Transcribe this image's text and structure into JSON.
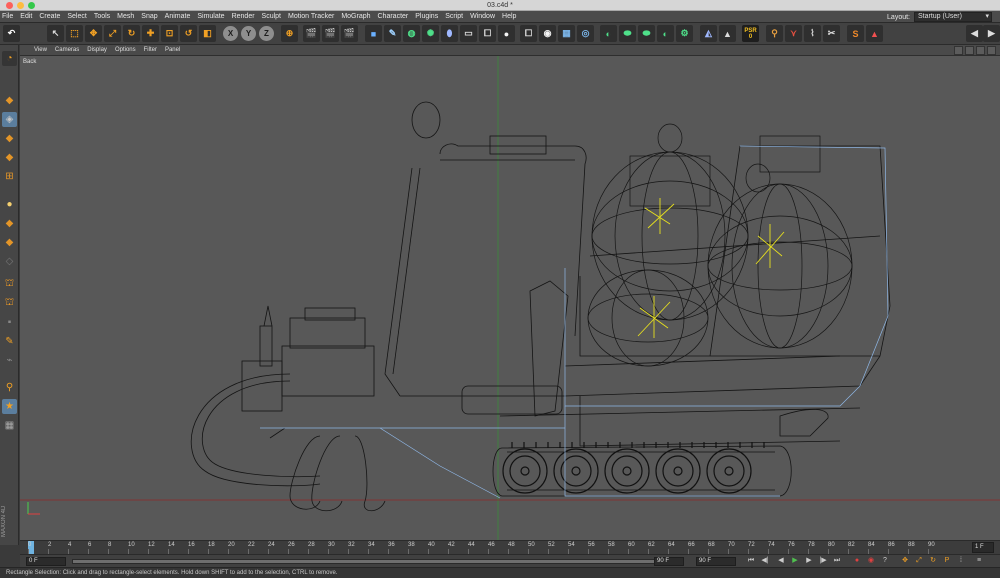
{
  "window": {
    "title": "03.c4d *"
  },
  "menubar": {
    "items": [
      "File",
      "Edit",
      "Create",
      "Select",
      "Tools",
      "Mesh",
      "Snap",
      "Animate",
      "Simulate",
      "Render",
      "Sculpt",
      "Motion Tracker",
      "MoGraph",
      "Character",
      "Plugins",
      "Script",
      "Window",
      "Help"
    ],
    "layout_label": "Layout:",
    "layout_value": "Startup (User)"
  },
  "toolbar": {
    "axis_x": "X",
    "axis_y": "Y",
    "axis_z": "Z",
    "psr_label": "PSR",
    "psr_value": "0"
  },
  "viewport": {
    "menu": [
      "View",
      "Cameras",
      "Display",
      "Options",
      "Filter",
      "Panel"
    ],
    "name": "Back"
  },
  "timeline": {
    "ticks": [
      "0",
      "2",
      "4",
      "6",
      "8",
      "10",
      "12",
      "14",
      "16",
      "18",
      "20",
      "22",
      "24",
      "26",
      "28",
      "30",
      "32",
      "34",
      "36",
      "38",
      "40",
      "42",
      "44",
      "46",
      "48",
      "50",
      "52",
      "54",
      "56",
      "58",
      "60",
      "62",
      "64",
      "66",
      "68",
      "70",
      "72",
      "74",
      "76",
      "78",
      "80",
      "82",
      "84",
      "86",
      "88",
      "90"
    ],
    "current_frame": "1 F"
  },
  "transport": {
    "start_frame": "0 F",
    "preview_end": "90 F",
    "end_frame": "90 F"
  },
  "statusbar": {
    "text": "Rectangle Selection: Click and drag to rectangle-select elements. Hold down SHIFT to add to the selection, CTRL to remove."
  },
  "colors": {
    "viewport_bg": "#585858",
    "accent_orange": "#f0a024",
    "wireframe_dark": "#121212",
    "selection_blue": "#8fb7e6",
    "highlight_yellow": "#e7e01e"
  }
}
